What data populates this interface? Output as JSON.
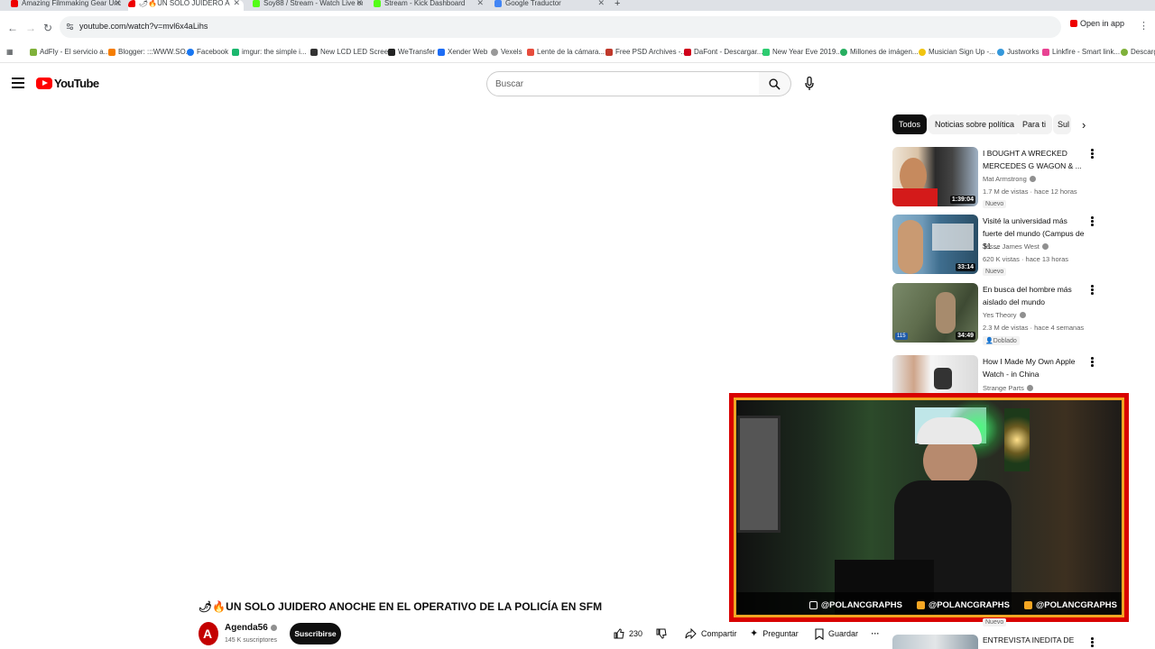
{
  "browser": {
    "tabs": [
      {
        "label": "Amazing Filmmaking Gear Unde"
      },
      {
        "label": "🌶🔥UN SOLO JUIDERO A"
      },
      {
        "label": "Soy88 / Stream - Watch Live on"
      },
      {
        "label": "Stream - Kick Dashboard"
      },
      {
        "label": "Google Traductor"
      }
    ],
    "new_tab": "+",
    "url": "youtube.com/watch?v=mvl6x4aLihs",
    "open_in_app": "Open in app",
    "bookmarks": [
      {
        "label": "AdFly - El servicio a..."
      },
      {
        "label": "Blogger: :::WWW.SO..."
      },
      {
        "label": "Facebook"
      },
      {
        "label": "imgur: the simple i..."
      },
      {
        "label": "New LCD LED Scree..."
      },
      {
        "label": "WeTransfer"
      },
      {
        "label": "Xender Web"
      },
      {
        "label": "Vexels"
      },
      {
        "label": "Lente de la cámara..."
      },
      {
        "label": "Free PSD Archives -..."
      },
      {
        "label": "DaFont - Descargar..."
      },
      {
        "label": "New Year Eve 2019..."
      },
      {
        "label": "Millones de imágen..."
      },
      {
        "label": "Musician Sign Up -..."
      },
      {
        "label": "Justworks"
      },
      {
        "label": "Linkfire - Smart link..."
      },
      {
        "label": "Descarg"
      }
    ]
  },
  "youtube": {
    "logo": "YouTube",
    "search_placeholder": "Buscar",
    "chips": [
      "Todos",
      "Noticias sobre política",
      "Para ti",
      "Sul"
    ],
    "recommendations": [
      {
        "title": "I BOUGHT A WRECKED MERCEDES G WAGON & ...",
        "channel": "Mat Armstrong",
        "meta": "1.7 M de vistas · hace 12 horas",
        "badge": "Nuevo",
        "duration": "1:39:04"
      },
      {
        "title": "Visité la universidad más fuerte del mundo (Campus de $1 ...",
        "channel": "Jesse James West",
        "meta": "620 K vistas · hace 13 horas",
        "badge": "Nuevo",
        "duration": "33:14"
      },
      {
        "title": "En busca del hombre más aislado del mundo",
        "channel": "Yes Theory",
        "meta": "2.3 M de vistas · hace 4 semanas",
        "badge": "Doblado",
        "duration": "34:49"
      },
      {
        "title": "How I Made My Own Apple Watch - in China",
        "channel": "Strange Parts",
        "meta": "",
        "badge": "",
        "duration": ""
      }
    ],
    "bottom_rec": {
      "title": "ENTREVISTA INEDITA DE",
      "badge": "Nuevo"
    },
    "video": {
      "title": "🌶🔥UN SOLO JUIDERO ANOCHE EN EL OPERATIVO DE LA POLICÍA EN SFM",
      "channel": "Agenda56",
      "subscribers": "145 K suscriptores",
      "subscribe": "Suscribirse",
      "likes": "230",
      "share": "Compartir",
      "ask": "Preguntar",
      "save": "Guardar"
    }
  },
  "webcam": {
    "socials": [
      {
        "network": "instagram",
        "handle": "@POLANCGRAPHS"
      },
      {
        "network": "youtube",
        "handle": "@POLANCGRAPHS"
      },
      {
        "network": "facebook",
        "handle": "@POLANCGRAPHS"
      }
    ],
    "frame_color": "#d80000",
    "accent_color": "#f5a623"
  }
}
